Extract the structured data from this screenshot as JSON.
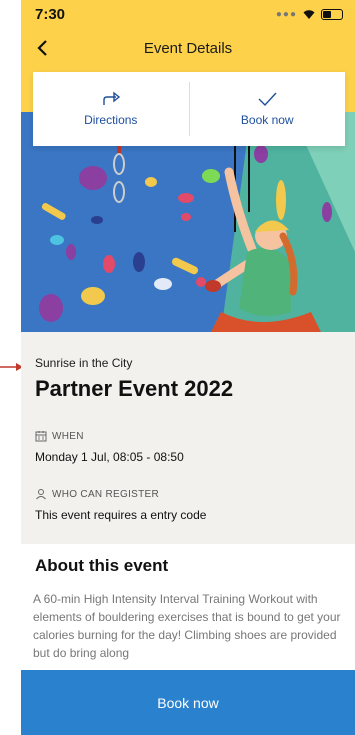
{
  "status_bar": {
    "time": "7:30"
  },
  "header": {
    "title": "Event Details"
  },
  "actions": {
    "directions_label": "Directions",
    "book_now_label": "Book now"
  },
  "event": {
    "organizer": "Sunrise in the City",
    "title": "Partner Event 2022",
    "when_label": "WHEN",
    "when_value": "Monday 1 Jul, 08:05 - 08:50",
    "who_label": "WHO CAN REGISTER",
    "who_value": "This event requires a entry code"
  },
  "about": {
    "heading": "About this event",
    "body": "A 60-min High Intensity Interval Training Workout with elements of bouldering exercises that is bound to get your calories burning for the day! Climbing shoes are provided but do bring along"
  },
  "footer": {
    "book_now_label": "Book now"
  },
  "colors": {
    "header": "#fdd24a",
    "accent": "#2a82cf",
    "link": "#1e4f9c",
    "pointer": "#c0392b"
  }
}
